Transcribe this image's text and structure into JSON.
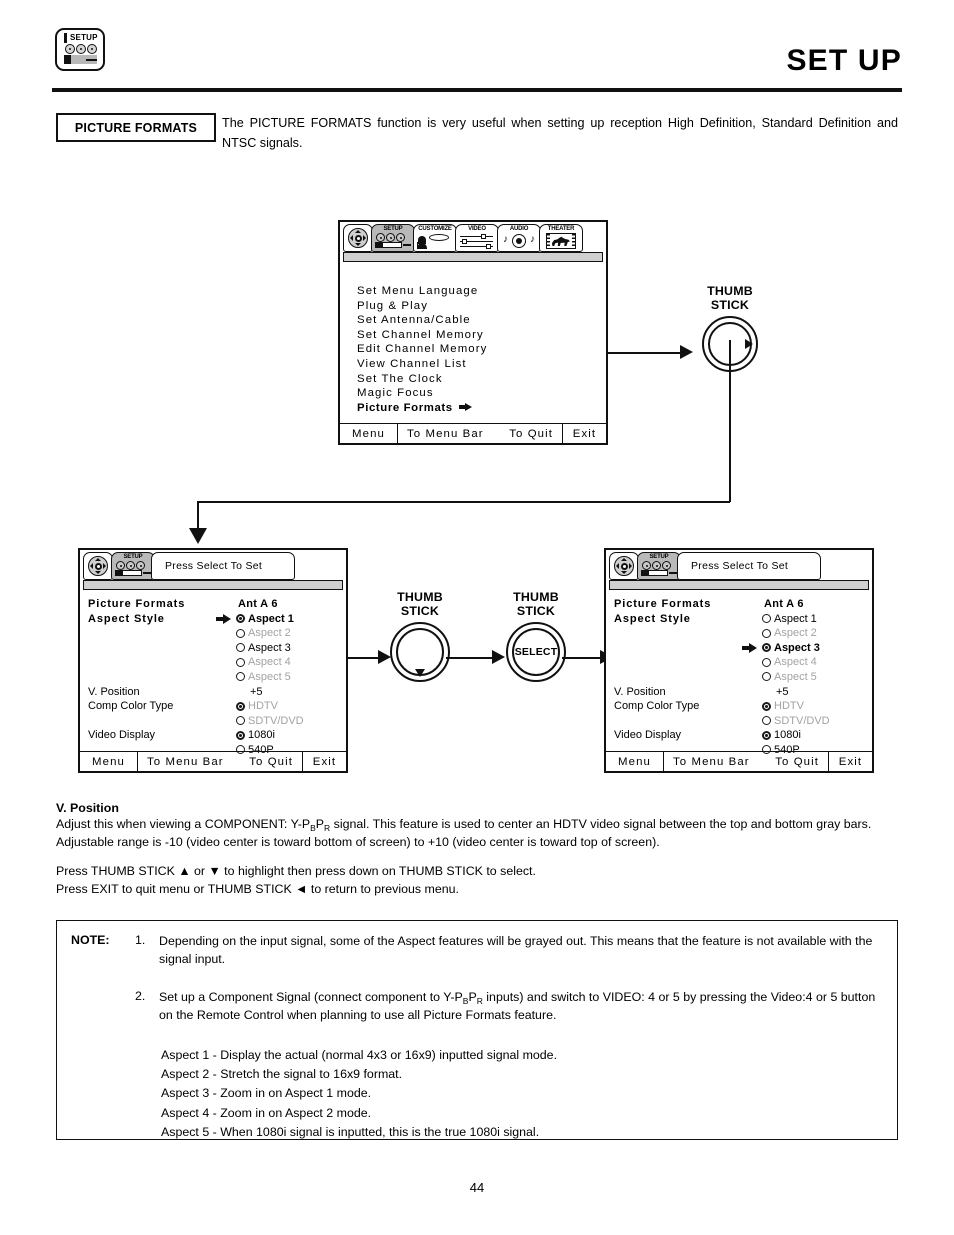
{
  "header": {
    "icon_label": "SETUP",
    "title": "SET UP"
  },
  "intro": {
    "badge": "PICTURE FORMATS",
    "text": "The PICTURE FORMATS function is very useful when setting up reception High Definition, Standard Definition and NTSC signals."
  },
  "menu_bar_tabs": [
    {
      "label": "",
      "icon": "navigation-pad-icon",
      "selected": false
    },
    {
      "label": "SETUP",
      "icon": "setup-camera-icon",
      "selected": true
    },
    {
      "label": "CUSTOMIZE",
      "icon": "customize-person-icon",
      "selected": false
    },
    {
      "label": "VIDEO",
      "icon": "video-sliders-icon",
      "selected": false
    },
    {
      "label": "AUDIO",
      "icon": "audio-speaker-icon",
      "selected": false
    },
    {
      "label": "THEATER",
      "icon": "theater-film-icon",
      "selected": false
    }
  ],
  "setup_menu": {
    "items": [
      "Set Menu Language",
      "Plug & Play",
      "Set Antenna/Cable",
      "Set Channel Memory",
      "Edit Channel Memory",
      "View Channel List",
      "Set The Clock",
      "Magic Focus"
    ],
    "selected_item": "Picture Formats",
    "bottom_bar": {
      "menu": "Menu",
      "to_menu_bar": "To Menu Bar",
      "to_quit": "To Quit",
      "exit": "Exit"
    }
  },
  "screen_left": {
    "tab_hint": "Press Select To Set",
    "tab_label": "SETUP",
    "title": "Picture Formats",
    "channel": "Ant A 6",
    "aspect_label": "Aspect Style",
    "aspect_options": [
      {
        "label": "Aspect 1",
        "selected": true,
        "grayed": false,
        "cursor": true
      },
      {
        "label": "Aspect 2",
        "selected": false,
        "grayed": true,
        "cursor": false
      },
      {
        "label": "Aspect 3",
        "selected": false,
        "grayed": false,
        "cursor": false
      },
      {
        "label": "Aspect 4",
        "selected": false,
        "grayed": true,
        "cursor": false
      },
      {
        "label": "Aspect 5",
        "selected": false,
        "grayed": true,
        "cursor": false
      }
    ],
    "v_position_label": "V. Position",
    "v_position_value": "+5",
    "comp_color_label": "Comp Color Type",
    "comp_color_options": [
      {
        "label": "HDTV",
        "selected": true,
        "grayed": true
      },
      {
        "label": "SDTV/DVD",
        "selected": false,
        "grayed": true
      }
    ],
    "video_display_label": "Video Display",
    "video_display_options": [
      {
        "label": "1080i",
        "selected": true,
        "grayed": false
      },
      {
        "label": "540P",
        "selected": false,
        "grayed": false
      }
    ],
    "bottom_bar": {
      "menu": "Menu",
      "to_menu_bar": "To Menu Bar",
      "to_quit": "To Quit",
      "exit": "Exit"
    }
  },
  "screen_right": {
    "tab_hint": "Press Select To Set",
    "tab_label": "SETUP",
    "title": "Picture Formats",
    "channel": "Ant A 6",
    "aspect_label": "Aspect Style",
    "aspect_options": [
      {
        "label": "Aspect 1",
        "selected": false,
        "grayed": false,
        "cursor": false
      },
      {
        "label": "Aspect 2",
        "selected": false,
        "grayed": true,
        "cursor": false
      },
      {
        "label": "Aspect 3",
        "selected": true,
        "grayed": false,
        "cursor": true
      },
      {
        "label": "Aspect 4",
        "selected": false,
        "grayed": true,
        "cursor": false
      },
      {
        "label": "Aspect 5",
        "selected": false,
        "grayed": true,
        "cursor": false
      }
    ],
    "v_position_label": "V. Position",
    "v_position_value": "+5",
    "comp_color_label": "Comp Color Type",
    "comp_color_options": [
      {
        "label": "HDTV",
        "selected": true,
        "grayed": true
      },
      {
        "label": "SDTV/DVD",
        "selected": false,
        "grayed": true
      }
    ],
    "video_display_label": "Video Display",
    "video_display_options": [
      {
        "label": "1080i",
        "selected": true,
        "grayed": false
      },
      {
        "label": "540P",
        "selected": false,
        "grayed": false
      }
    ],
    "bottom_bar": {
      "menu": "Menu",
      "to_menu_bar": "To Menu Bar",
      "to_quit": "To Quit",
      "exit": "Exit"
    }
  },
  "thumb_sticks": {
    "top": {
      "line1": "THUMB",
      "line2": "STICK",
      "glyph": "right-arrow"
    },
    "mid_left": {
      "line1": "THUMB",
      "line2": "STICK",
      "glyph": "down-arrow"
    },
    "mid_right": {
      "line1": "THUMB",
      "line2": "STICK",
      "glyph": "SELECT"
    }
  },
  "v_position_section": {
    "heading": "V. Position",
    "para1_a": "Adjust this when viewing a COMPONENT: Y-P",
    "para1_sub1": "B",
    "para1_b": "P",
    "para1_sub2": "R",
    "para1_c": " signal.  This feature is used to center an HDTV video signal between the top and bottom gray bars.  Adjustable range is -10 (video center is toward bottom of screen) to +10 (video center is toward top of screen).",
    "line_press_1": "Press THUMB STICK ▲ or ▼ to highlight then press down on THUMB STICK to select.",
    "line_press_2": "Press EXIT to quit menu or THUMB STICK ◄ to return to previous menu."
  },
  "note": {
    "label": "NOTE:",
    "item1_num": "1.",
    "item1": "Depending on the input signal, some of the Aspect features will be grayed out.  This means that the feature is not available with the signal input.",
    "item2_num": "2.",
    "item2_a": "Set up a Component Signal (connect component to Y-P",
    "item2_sub1": "B",
    "item2_b": "P",
    "item2_sub2": "R",
    "item2_c": " inputs) and switch to VIDEO: 4 or 5 by pressing the Video:4 or 5 button on the Remote Control when planning to use all Picture Formats feature.",
    "aspect_descriptions": [
      "Aspect 1 - Display the actual (normal 4x3 or 16x9) inputted signal mode.",
      "Aspect 2 - Stretch the signal to 16x9 format.",
      "Aspect 3 - Zoom in on Aspect 1 mode.",
      "Aspect 4 - Zoom in on Aspect 2 mode.",
      "Aspect 5 - When 1080i signal is inputted, this is the true 1080i signal."
    ]
  },
  "page_number": "44"
}
